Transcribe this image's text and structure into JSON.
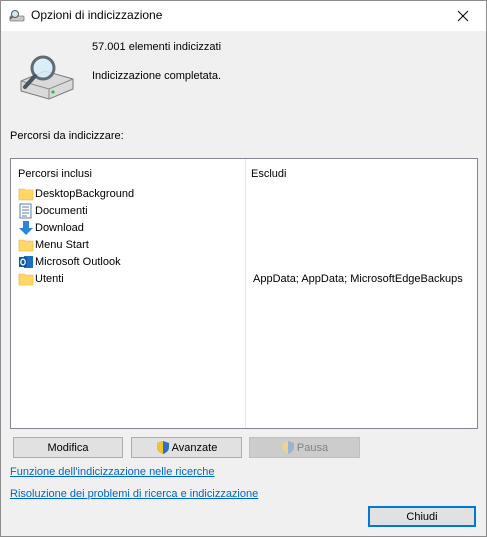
{
  "window": {
    "title": "Opzioni di indicizzazione"
  },
  "summary": {
    "count": "57.001 elementi indicizzati",
    "status": "Indicizzazione completata."
  },
  "section_label": "Percorsi da indicizzare:",
  "table": {
    "columns": [
      "Percorsi inclusi",
      "Escludi"
    ],
    "rows": [
      {
        "name": "DesktopBackground",
        "exclude": "",
        "icon": "folder-icon"
      },
      {
        "name": "Documenti",
        "exclude": "",
        "icon": "documents-icon"
      },
      {
        "name": "Download",
        "exclude": "",
        "icon": "download-icon"
      },
      {
        "name": "Menu Start",
        "exclude": "",
        "icon": "folder-icon"
      },
      {
        "name": "Microsoft Outlook",
        "exclude": "",
        "icon": "outlook-icon"
      },
      {
        "name": "Utenti",
        "exclude": "AppData; AppData; MicrosoftEdgeBackups",
        "icon": "folder-icon"
      }
    ]
  },
  "buttons": {
    "modify": "Modifica",
    "advanced": "Avanzate",
    "pause": "Pausa",
    "close": "Chiudi"
  },
  "links": {
    "how_indexing": "Funzione dell'indicizzazione nelle ricerche",
    "troubleshoot": "Risoluzione dei problemi di ricerca e indicizzazione"
  },
  "colors": {
    "link": "#0066cc",
    "folder": "#ffd766",
    "accent": "#0078d7"
  }
}
